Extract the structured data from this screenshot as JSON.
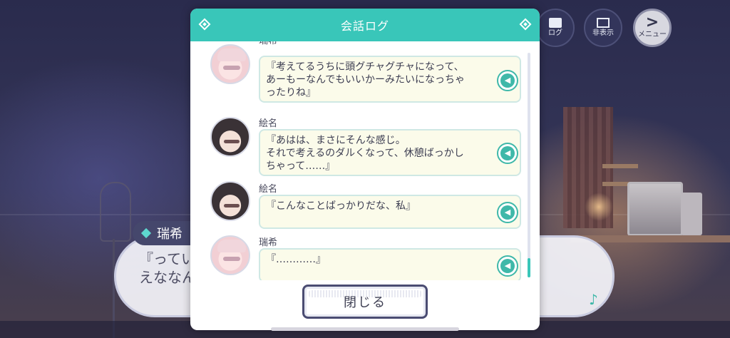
{
  "hud": {
    "log": {
      "label": "ログ",
      "icon": "log-icon"
    },
    "hide": {
      "label": "非表示",
      "icon": "hide-icon"
    },
    "menu": {
      "label": "メニュー",
      "icon": "chevron-right-icon",
      "glyph": ">"
    }
  },
  "dialogue": {
    "speaker": "瑞希",
    "text": "『ってい\nえななん"
  },
  "log_modal": {
    "title": "会話ログ",
    "entries": [
      {
        "speaker": "瑞希",
        "text": "『考えてるうちに頭グチャグチャになって、\nあーもーなんでもいいかーみたいになっちゃ\nったりね』",
        "avatar": "mizuki"
      },
      {
        "speaker": "絵名",
        "text": "『あはは、まさにそんな感じ。\nそれで考えるのダルくなって、休憩ばっかし\nちゃって……』",
        "avatar": "ena"
      },
      {
        "speaker": "絵名",
        "text": "『こんなことばっかりだな、私』",
        "avatar": "ena"
      },
      {
        "speaker": "瑞希",
        "text": "『…………』",
        "avatar": "mizuki"
      }
    ],
    "close_label": "閉じる"
  },
  "colors": {
    "accent": "#39c6b9",
    "panel_dark": "#45476c"
  }
}
